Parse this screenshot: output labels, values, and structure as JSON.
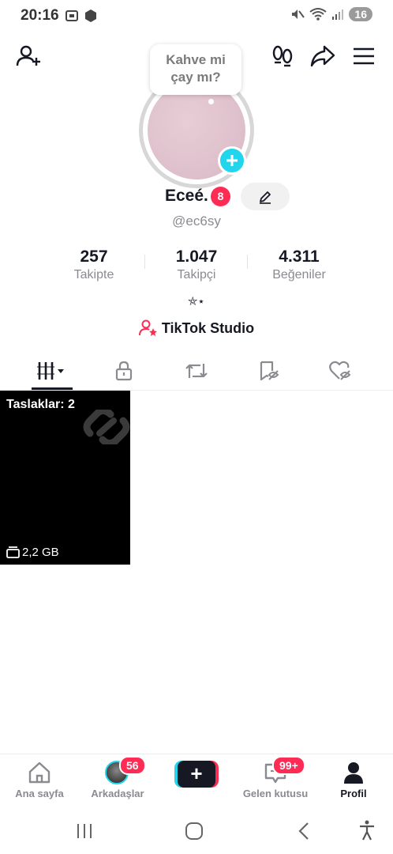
{
  "status_bar": {
    "time": "20:16",
    "battery": "16",
    "icons": [
      "screenshot-icon",
      "box-icon",
      "mute-icon",
      "wifi-icon",
      "signal-icon"
    ]
  },
  "header": {
    "icons": [
      "add-friend-icon",
      "footprints-icon",
      "share-icon",
      "menu-icon"
    ]
  },
  "profile": {
    "note_bubble": {
      "line1": "Kahve mi",
      "line2": "çay mı?"
    },
    "display_name": "Eceé.",
    "name_badge": "8",
    "username": "@ec6sy",
    "stats": [
      {
        "value": "257",
        "label": "Takipte"
      },
      {
        "value": "1.047",
        "label": "Takipçi"
      },
      {
        "value": "4.311",
        "label": "Beğeniler"
      }
    ],
    "bio": "⛤⋆",
    "studio_label": "TikTok Studio"
  },
  "tabs": [
    "videos-grid-icon",
    "private-lock-icon",
    "repost-icon",
    "saved-bookmark-icon",
    "liked-heart-icon"
  ],
  "drafts": {
    "label": "Taslaklar: 2",
    "size": "2,2 GB"
  },
  "bottom_nav": [
    {
      "label": "Ana sayfa"
    },
    {
      "label": "Arkadaşlar",
      "badge": "56"
    },
    {
      "label": "+"
    },
    {
      "label": "Gelen kutusu",
      "badge": "99+"
    },
    {
      "label": "Profil"
    }
  ],
  "colors": {
    "accent_red": "#fe2c55",
    "accent_cyan": "#20d5ec",
    "text_primary": "#161823",
    "text_secondary": "#8a8b91"
  }
}
